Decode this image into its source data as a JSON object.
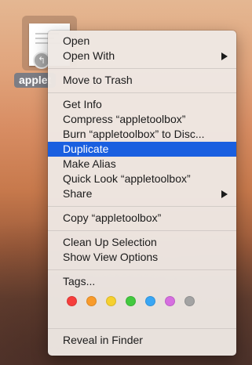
{
  "file": {
    "label": "applet",
    "alias_badge": "↰"
  },
  "menu": {
    "open": "Open",
    "open_with": "Open With",
    "move_to_trash": "Move to Trash",
    "get_info": "Get Info",
    "compress": "Compress “appletoolbox”",
    "burn": "Burn “appletoolbox” to Disc...",
    "duplicate": "Duplicate",
    "make_alias": "Make Alias",
    "quick_look": "Quick Look “appletoolbox”",
    "share": "Share",
    "copy": "Copy “appletoolbox”",
    "clean_up": "Clean Up Selection",
    "view_options": "Show View Options",
    "tags": "Tags...",
    "reveal": "Reveal in Finder"
  },
  "highlighted_item": "Duplicate",
  "tag_colors": [
    {
      "name": "red-tag",
      "color": "#f63e3c"
    },
    {
      "name": "orange-tag",
      "color": "#f89b2b"
    },
    {
      "name": "yellow-tag",
      "color": "#f6d02f"
    },
    {
      "name": "green-tag",
      "color": "#43c93f"
    },
    {
      "name": "blue-tag",
      "color": "#39a6f4"
    },
    {
      "name": "purple-tag",
      "color": "#d66ee0"
    },
    {
      "name": "gray-tag",
      "color": "#a3a3a3"
    }
  ]
}
